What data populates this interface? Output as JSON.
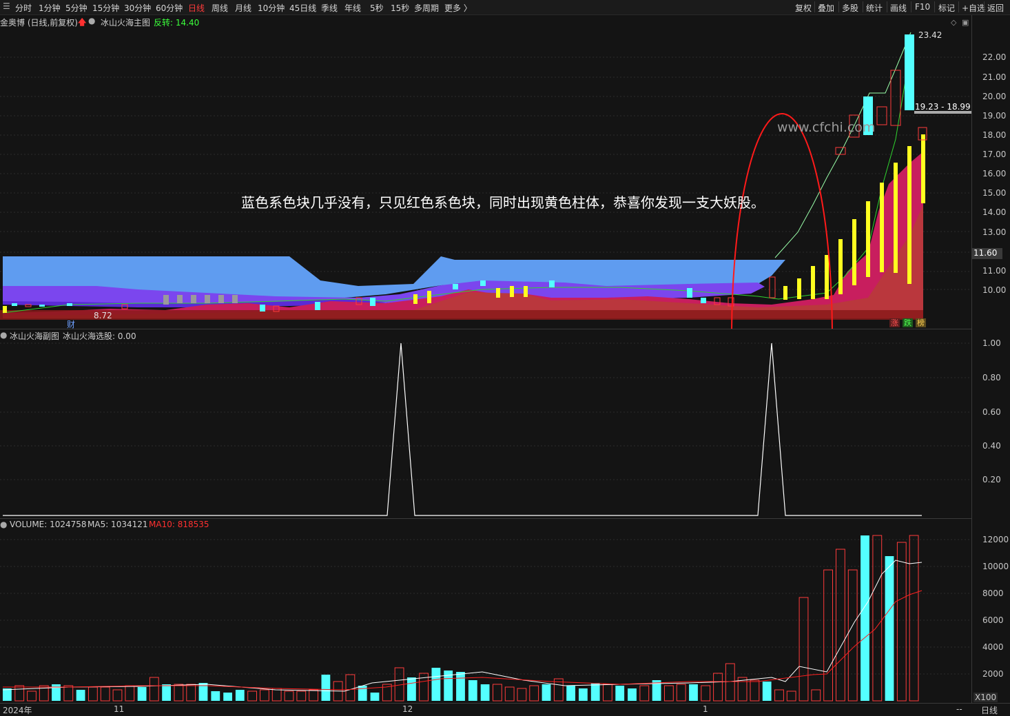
{
  "toolbar": {
    "menu_icon": "list-icon",
    "periods": [
      "分时",
      "1分钟",
      "5分钟",
      "15分钟",
      "30分钟",
      "60分钟",
      "日线",
      "周线",
      "月线",
      "10分钟",
      "45日线",
      "季线",
      "年线",
      "5秒",
      "15秒",
      "多周期",
      "更多 〉"
    ],
    "active_period": "日线",
    "right_buttons": [
      "复权",
      "叠加",
      "多股",
      "统计",
      "画线",
      "F10",
      "标记",
      "+自选",
      "返回"
    ]
  },
  "main_title": {
    "stock": "金奥博 (日线,前复权)",
    "indicator": "冰山火海主图",
    "reversal": "反转: 14.40"
  },
  "price_axis": [
    "22.00",
    "21.00",
    "20.00",
    "19.00",
    "18.00",
    "17.00",
    "16.00",
    "15.00",
    "14.00",
    "13.00",
    "12.00",
    "11.00",
    "10.00"
  ],
  "current_price_tag": "11.60",
  "high_label": "23.42",
  "low_label": "8.72",
  "range_tag": "19.23 - 18.99",
  "annotation": "蓝色系色块几乎没有，只见红色系色块，同时出现黄色柱体，恭喜你发现一支大妖股。",
  "watermark": "www.cfchi.com",
  "cai_label": "财",
  "badges": [
    "涨",
    "跌",
    "榜"
  ],
  "sub_title": {
    "name": "冰山火海副图",
    "value": "冰山火海选股: 0.00"
  },
  "sub_axis": [
    "1.00",
    "0.80",
    "0.60",
    "0.40",
    "0.20"
  ],
  "volume_title": {
    "volume": "VOLUME: 1024758",
    "ma5": "MA5: 1034121",
    "ma10": "MA10: 818535"
  },
  "volume_axis": [
    "12000",
    "10000",
    "8000",
    "6000",
    "4000",
    "2000"
  ],
  "volume_unit": "X100",
  "x_axis": [
    "2024年",
    "11",
    "12",
    "1"
  ],
  "bottom_right": {
    "dash": "--",
    "period": "日线"
  },
  "colors": {
    "up": "#ff3b3b",
    "down": "#54ffff",
    "yellow": "#ffff00",
    "blue": "#4a7bff",
    "red": "#d21e5a",
    "ellipse": "#ff1a1a"
  },
  "chart_data": {
    "type": "candlestick",
    "signal_series": {
      "name": "冰山火海选股",
      "peaks": [
        {
          "x": "2024-12 (early)",
          "y": 1.0
        },
        {
          "x": "2025-01 (mid)",
          "y": 1.0
        }
      ],
      "baseline": 0
    },
    "volume_ylim": [
      0,
      12000
    ],
    "price_ylim": [
      8.72,
      23.42
    ]
  }
}
